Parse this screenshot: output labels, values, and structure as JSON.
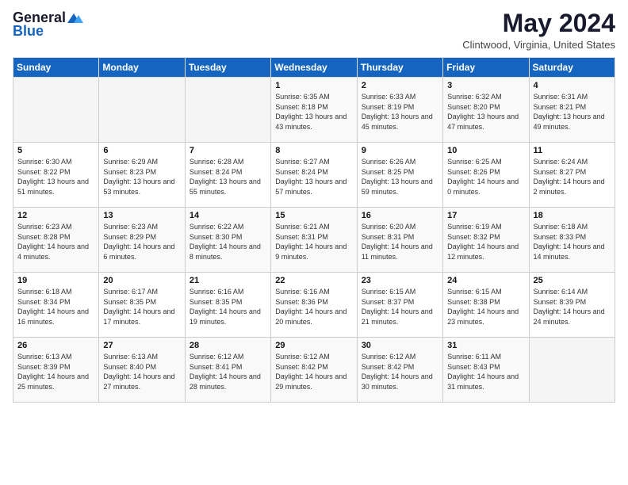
{
  "logo": {
    "line1": "General",
    "line2": "Blue"
  },
  "title": {
    "main": "May 2024",
    "sub": "Clintwood, Virginia, United States"
  },
  "headers": [
    "Sunday",
    "Monday",
    "Tuesday",
    "Wednesday",
    "Thursday",
    "Friday",
    "Saturday"
  ],
  "weeks": [
    [
      {
        "day": "",
        "sunrise": "",
        "sunset": "",
        "daylight": ""
      },
      {
        "day": "",
        "sunrise": "",
        "sunset": "",
        "daylight": ""
      },
      {
        "day": "",
        "sunrise": "",
        "sunset": "",
        "daylight": ""
      },
      {
        "day": "1",
        "sunrise": "Sunrise: 6:35 AM",
        "sunset": "Sunset: 8:18 PM",
        "daylight": "Daylight: 13 hours and 43 minutes."
      },
      {
        "day": "2",
        "sunrise": "Sunrise: 6:33 AM",
        "sunset": "Sunset: 8:19 PM",
        "daylight": "Daylight: 13 hours and 45 minutes."
      },
      {
        "day": "3",
        "sunrise": "Sunrise: 6:32 AM",
        "sunset": "Sunset: 8:20 PM",
        "daylight": "Daylight: 13 hours and 47 minutes."
      },
      {
        "day": "4",
        "sunrise": "Sunrise: 6:31 AM",
        "sunset": "Sunset: 8:21 PM",
        "daylight": "Daylight: 13 hours and 49 minutes."
      }
    ],
    [
      {
        "day": "5",
        "sunrise": "Sunrise: 6:30 AM",
        "sunset": "Sunset: 8:22 PM",
        "daylight": "Daylight: 13 hours and 51 minutes."
      },
      {
        "day": "6",
        "sunrise": "Sunrise: 6:29 AM",
        "sunset": "Sunset: 8:23 PM",
        "daylight": "Daylight: 13 hours and 53 minutes."
      },
      {
        "day": "7",
        "sunrise": "Sunrise: 6:28 AM",
        "sunset": "Sunset: 8:24 PM",
        "daylight": "Daylight: 13 hours and 55 minutes."
      },
      {
        "day": "8",
        "sunrise": "Sunrise: 6:27 AM",
        "sunset": "Sunset: 8:24 PM",
        "daylight": "Daylight: 13 hours and 57 minutes."
      },
      {
        "day": "9",
        "sunrise": "Sunrise: 6:26 AM",
        "sunset": "Sunset: 8:25 PM",
        "daylight": "Daylight: 13 hours and 59 minutes."
      },
      {
        "day": "10",
        "sunrise": "Sunrise: 6:25 AM",
        "sunset": "Sunset: 8:26 PM",
        "daylight": "Daylight: 14 hours and 0 minutes."
      },
      {
        "day": "11",
        "sunrise": "Sunrise: 6:24 AM",
        "sunset": "Sunset: 8:27 PM",
        "daylight": "Daylight: 14 hours and 2 minutes."
      }
    ],
    [
      {
        "day": "12",
        "sunrise": "Sunrise: 6:23 AM",
        "sunset": "Sunset: 8:28 PM",
        "daylight": "Daylight: 14 hours and 4 minutes."
      },
      {
        "day": "13",
        "sunrise": "Sunrise: 6:23 AM",
        "sunset": "Sunset: 8:29 PM",
        "daylight": "Daylight: 14 hours and 6 minutes."
      },
      {
        "day": "14",
        "sunrise": "Sunrise: 6:22 AM",
        "sunset": "Sunset: 8:30 PM",
        "daylight": "Daylight: 14 hours and 8 minutes."
      },
      {
        "day": "15",
        "sunrise": "Sunrise: 6:21 AM",
        "sunset": "Sunset: 8:31 PM",
        "daylight": "Daylight: 14 hours and 9 minutes."
      },
      {
        "day": "16",
        "sunrise": "Sunrise: 6:20 AM",
        "sunset": "Sunset: 8:31 PM",
        "daylight": "Daylight: 14 hours and 11 minutes."
      },
      {
        "day": "17",
        "sunrise": "Sunrise: 6:19 AM",
        "sunset": "Sunset: 8:32 PM",
        "daylight": "Daylight: 14 hours and 12 minutes."
      },
      {
        "day": "18",
        "sunrise": "Sunrise: 6:18 AM",
        "sunset": "Sunset: 8:33 PM",
        "daylight": "Daylight: 14 hours and 14 minutes."
      }
    ],
    [
      {
        "day": "19",
        "sunrise": "Sunrise: 6:18 AM",
        "sunset": "Sunset: 8:34 PM",
        "daylight": "Daylight: 14 hours and 16 minutes."
      },
      {
        "day": "20",
        "sunrise": "Sunrise: 6:17 AM",
        "sunset": "Sunset: 8:35 PM",
        "daylight": "Daylight: 14 hours and 17 minutes."
      },
      {
        "day": "21",
        "sunrise": "Sunrise: 6:16 AM",
        "sunset": "Sunset: 8:35 PM",
        "daylight": "Daylight: 14 hours and 19 minutes."
      },
      {
        "day": "22",
        "sunrise": "Sunrise: 6:16 AM",
        "sunset": "Sunset: 8:36 PM",
        "daylight": "Daylight: 14 hours and 20 minutes."
      },
      {
        "day": "23",
        "sunrise": "Sunrise: 6:15 AM",
        "sunset": "Sunset: 8:37 PM",
        "daylight": "Daylight: 14 hours and 21 minutes."
      },
      {
        "day": "24",
        "sunrise": "Sunrise: 6:15 AM",
        "sunset": "Sunset: 8:38 PM",
        "daylight": "Daylight: 14 hours and 23 minutes."
      },
      {
        "day": "25",
        "sunrise": "Sunrise: 6:14 AM",
        "sunset": "Sunset: 8:39 PM",
        "daylight": "Daylight: 14 hours and 24 minutes."
      }
    ],
    [
      {
        "day": "26",
        "sunrise": "Sunrise: 6:13 AM",
        "sunset": "Sunset: 8:39 PM",
        "daylight": "Daylight: 14 hours and 25 minutes."
      },
      {
        "day": "27",
        "sunrise": "Sunrise: 6:13 AM",
        "sunset": "Sunset: 8:40 PM",
        "daylight": "Daylight: 14 hours and 27 minutes."
      },
      {
        "day": "28",
        "sunrise": "Sunrise: 6:12 AM",
        "sunset": "Sunset: 8:41 PM",
        "daylight": "Daylight: 14 hours and 28 minutes."
      },
      {
        "day": "29",
        "sunrise": "Sunrise: 6:12 AM",
        "sunset": "Sunset: 8:42 PM",
        "daylight": "Daylight: 14 hours and 29 minutes."
      },
      {
        "day": "30",
        "sunrise": "Sunrise: 6:12 AM",
        "sunset": "Sunset: 8:42 PM",
        "daylight": "Daylight: 14 hours and 30 minutes."
      },
      {
        "day": "31",
        "sunrise": "Sunrise: 6:11 AM",
        "sunset": "Sunset: 8:43 PM",
        "daylight": "Daylight: 14 hours and 31 minutes."
      },
      {
        "day": "",
        "sunrise": "",
        "sunset": "",
        "daylight": ""
      }
    ]
  ]
}
